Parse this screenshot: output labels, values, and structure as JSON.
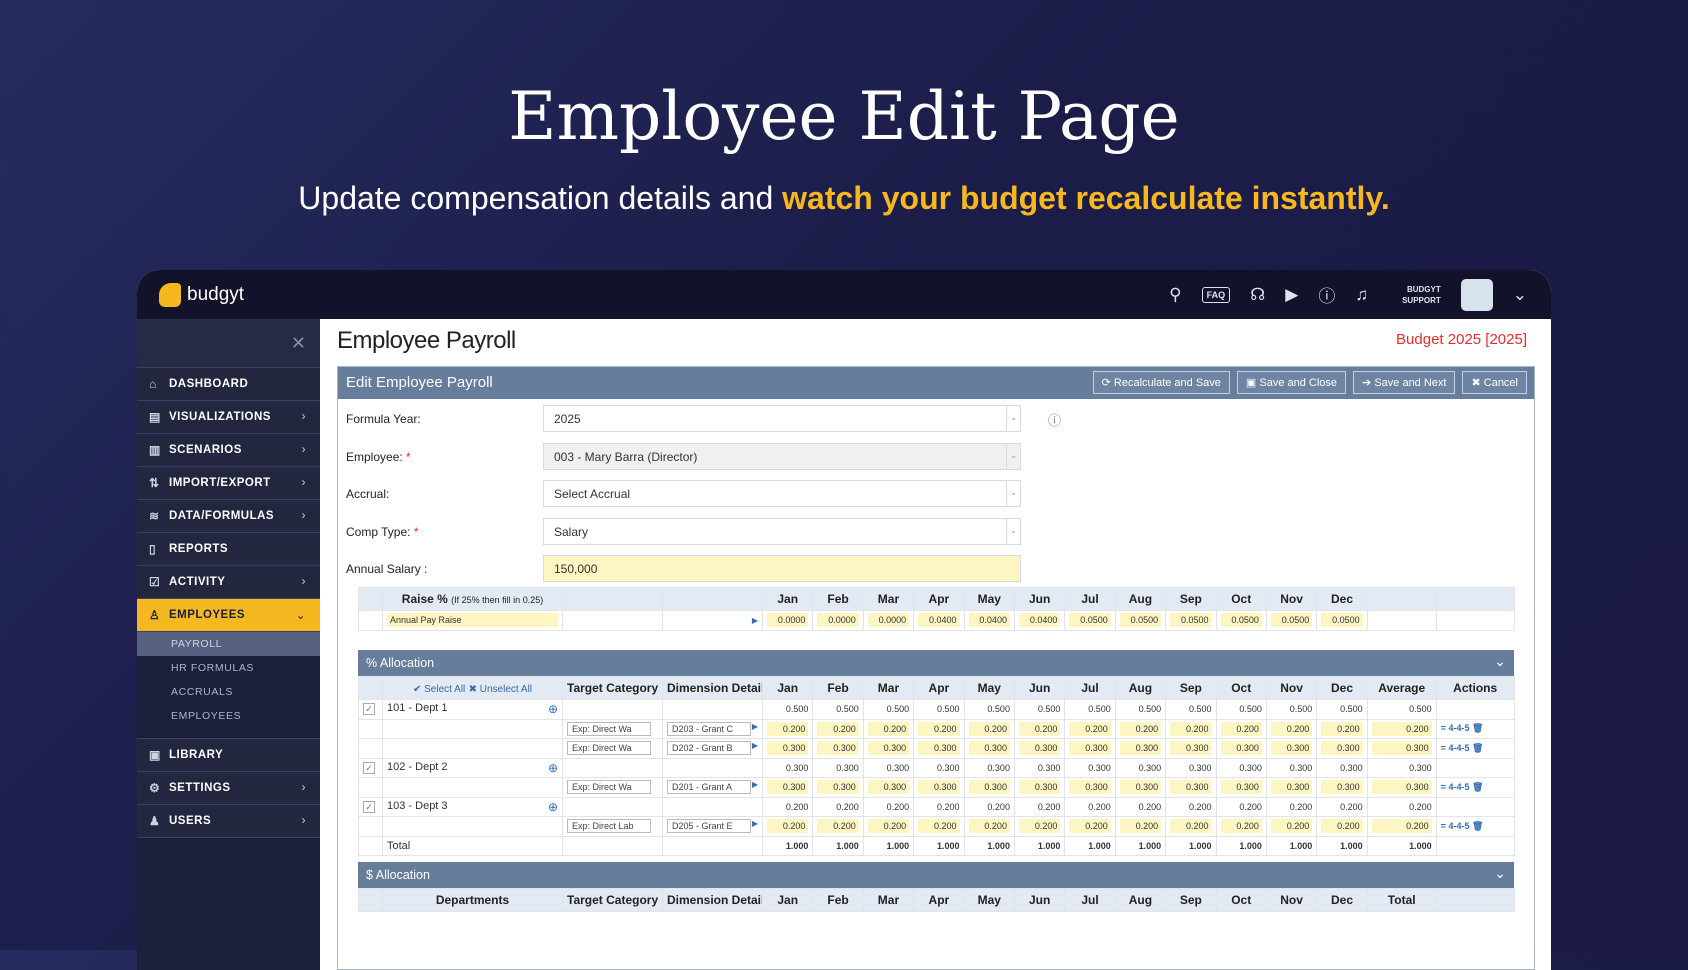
{
  "hero": {
    "title": "Employee Edit Page",
    "subtitle_plain": "Update compensation details and ",
    "subtitle_highlight": "watch your budget recalculate instantly."
  },
  "topbar": {
    "logo": "budgyt",
    "faq": "FAQ",
    "user_line1": "BUDGYT",
    "user_line2": "SUPPORT"
  },
  "sidebar": {
    "items": [
      {
        "label": "DASHBOARD",
        "icon": "⌂",
        "chev": false
      },
      {
        "label": "VISUALIZATIONS",
        "icon": "▤",
        "chev": true
      },
      {
        "label": "SCENARIOS",
        "icon": "▥",
        "chev": true
      },
      {
        "label": "IMPORT/EXPORT",
        "icon": "⇅",
        "chev": true
      },
      {
        "label": "DATA/FORMULAS",
        "icon": "≋",
        "chev": true
      },
      {
        "label": "REPORTS",
        "icon": "▯",
        "chev": false
      },
      {
        "label": "ACTIVITY",
        "icon": "☑",
        "chev": true
      },
      {
        "label": "EMPLOYEES",
        "icon": "♙",
        "chev": true,
        "active": true
      }
    ],
    "sub": [
      "PAYROLL",
      "HR FORMULAS",
      "ACCRUALS",
      "EMPLOYEES"
    ],
    "items2": [
      {
        "label": "LIBRARY",
        "icon": "▣",
        "chev": false
      },
      {
        "label": "SETTINGS",
        "icon": "⚙",
        "chev": true
      },
      {
        "label": "USERS",
        "icon": "♟",
        "chev": true
      }
    ]
  },
  "page": {
    "title": "Employee Payroll",
    "budget": "Budget 2025 [2025]"
  },
  "panel": {
    "title": "Edit Employee Payroll",
    "buttons": [
      "⟳ Recalculate and Save",
      "▣ Save and Close",
      "➔ Save and Next",
      "✖ Cancel"
    ]
  },
  "form": [
    {
      "label": "Formula Year:",
      "value": "2025",
      "req": false
    },
    {
      "label": "Employee:",
      "value": "003 - Mary Barra (Director)",
      "req": true
    },
    {
      "label": "Accrual:",
      "value": "Select Accrual",
      "req": false
    },
    {
      "label": "Comp Type:",
      "value": "Salary",
      "req": true
    },
    {
      "label": "Annual Salary :",
      "value": "150,000",
      "req": false
    }
  ],
  "months": [
    "Jan",
    "Feb",
    "Mar",
    "Apr",
    "May",
    "Jun",
    "Jul",
    "Aug",
    "Sep",
    "Oct",
    "Nov",
    "Dec"
  ],
  "raise": {
    "header": "Raise %",
    "hint": "(If 25% then fill in 0.25)",
    "row_label": "Annual Pay Raise",
    "values": [
      "0.0000",
      "0.0000",
      "0.0000",
      "0.0400",
      "0.0400",
      "0.0400",
      "0.0500",
      "0.0500",
      "0.0500",
      "0.0500",
      "0.0500",
      "0.0500"
    ]
  },
  "pct_alloc": {
    "title": "% Allocation",
    "select_all": "✔ Select All",
    "unselect_all": "✖ Unselect All",
    "cols": [
      "Target Category",
      "Dimension Detail",
      "Average",
      "Actions"
    ],
    "rows": [
      {
        "type": "dept",
        "name": "101 - Dept 1",
        "val": "0.500"
      },
      {
        "type": "line",
        "target": "Exp: Direct Wa",
        "dim": "D203 - Grant C",
        "val": "0.200",
        "action": "4-4-5"
      },
      {
        "type": "line",
        "target": "Exp: Direct Wa",
        "dim": "D202 - Grant B",
        "val": "0.300",
        "action": "4-4-5"
      },
      {
        "type": "dept",
        "name": "102 - Dept 2",
        "val": "0.300"
      },
      {
        "type": "line",
        "target": "Exp: Direct Wa",
        "dim": "D201 - Grant A",
        "val": "0.300",
        "action": "4-4-5"
      },
      {
        "type": "dept",
        "name": "103 - Dept 3",
        "val": "0.200"
      },
      {
        "type": "line",
        "target": "Exp: Direct Lab",
        "dim": "D205 - Grant E",
        "val": "0.200",
        "action": "4-4-5"
      },
      {
        "type": "total",
        "name": "Total",
        "val": "1.000"
      }
    ]
  },
  "dollar_alloc": {
    "title": "$ Allocation",
    "cols": [
      "Departments",
      "Target Category",
      "Dimension Detail",
      "Total"
    ]
  }
}
